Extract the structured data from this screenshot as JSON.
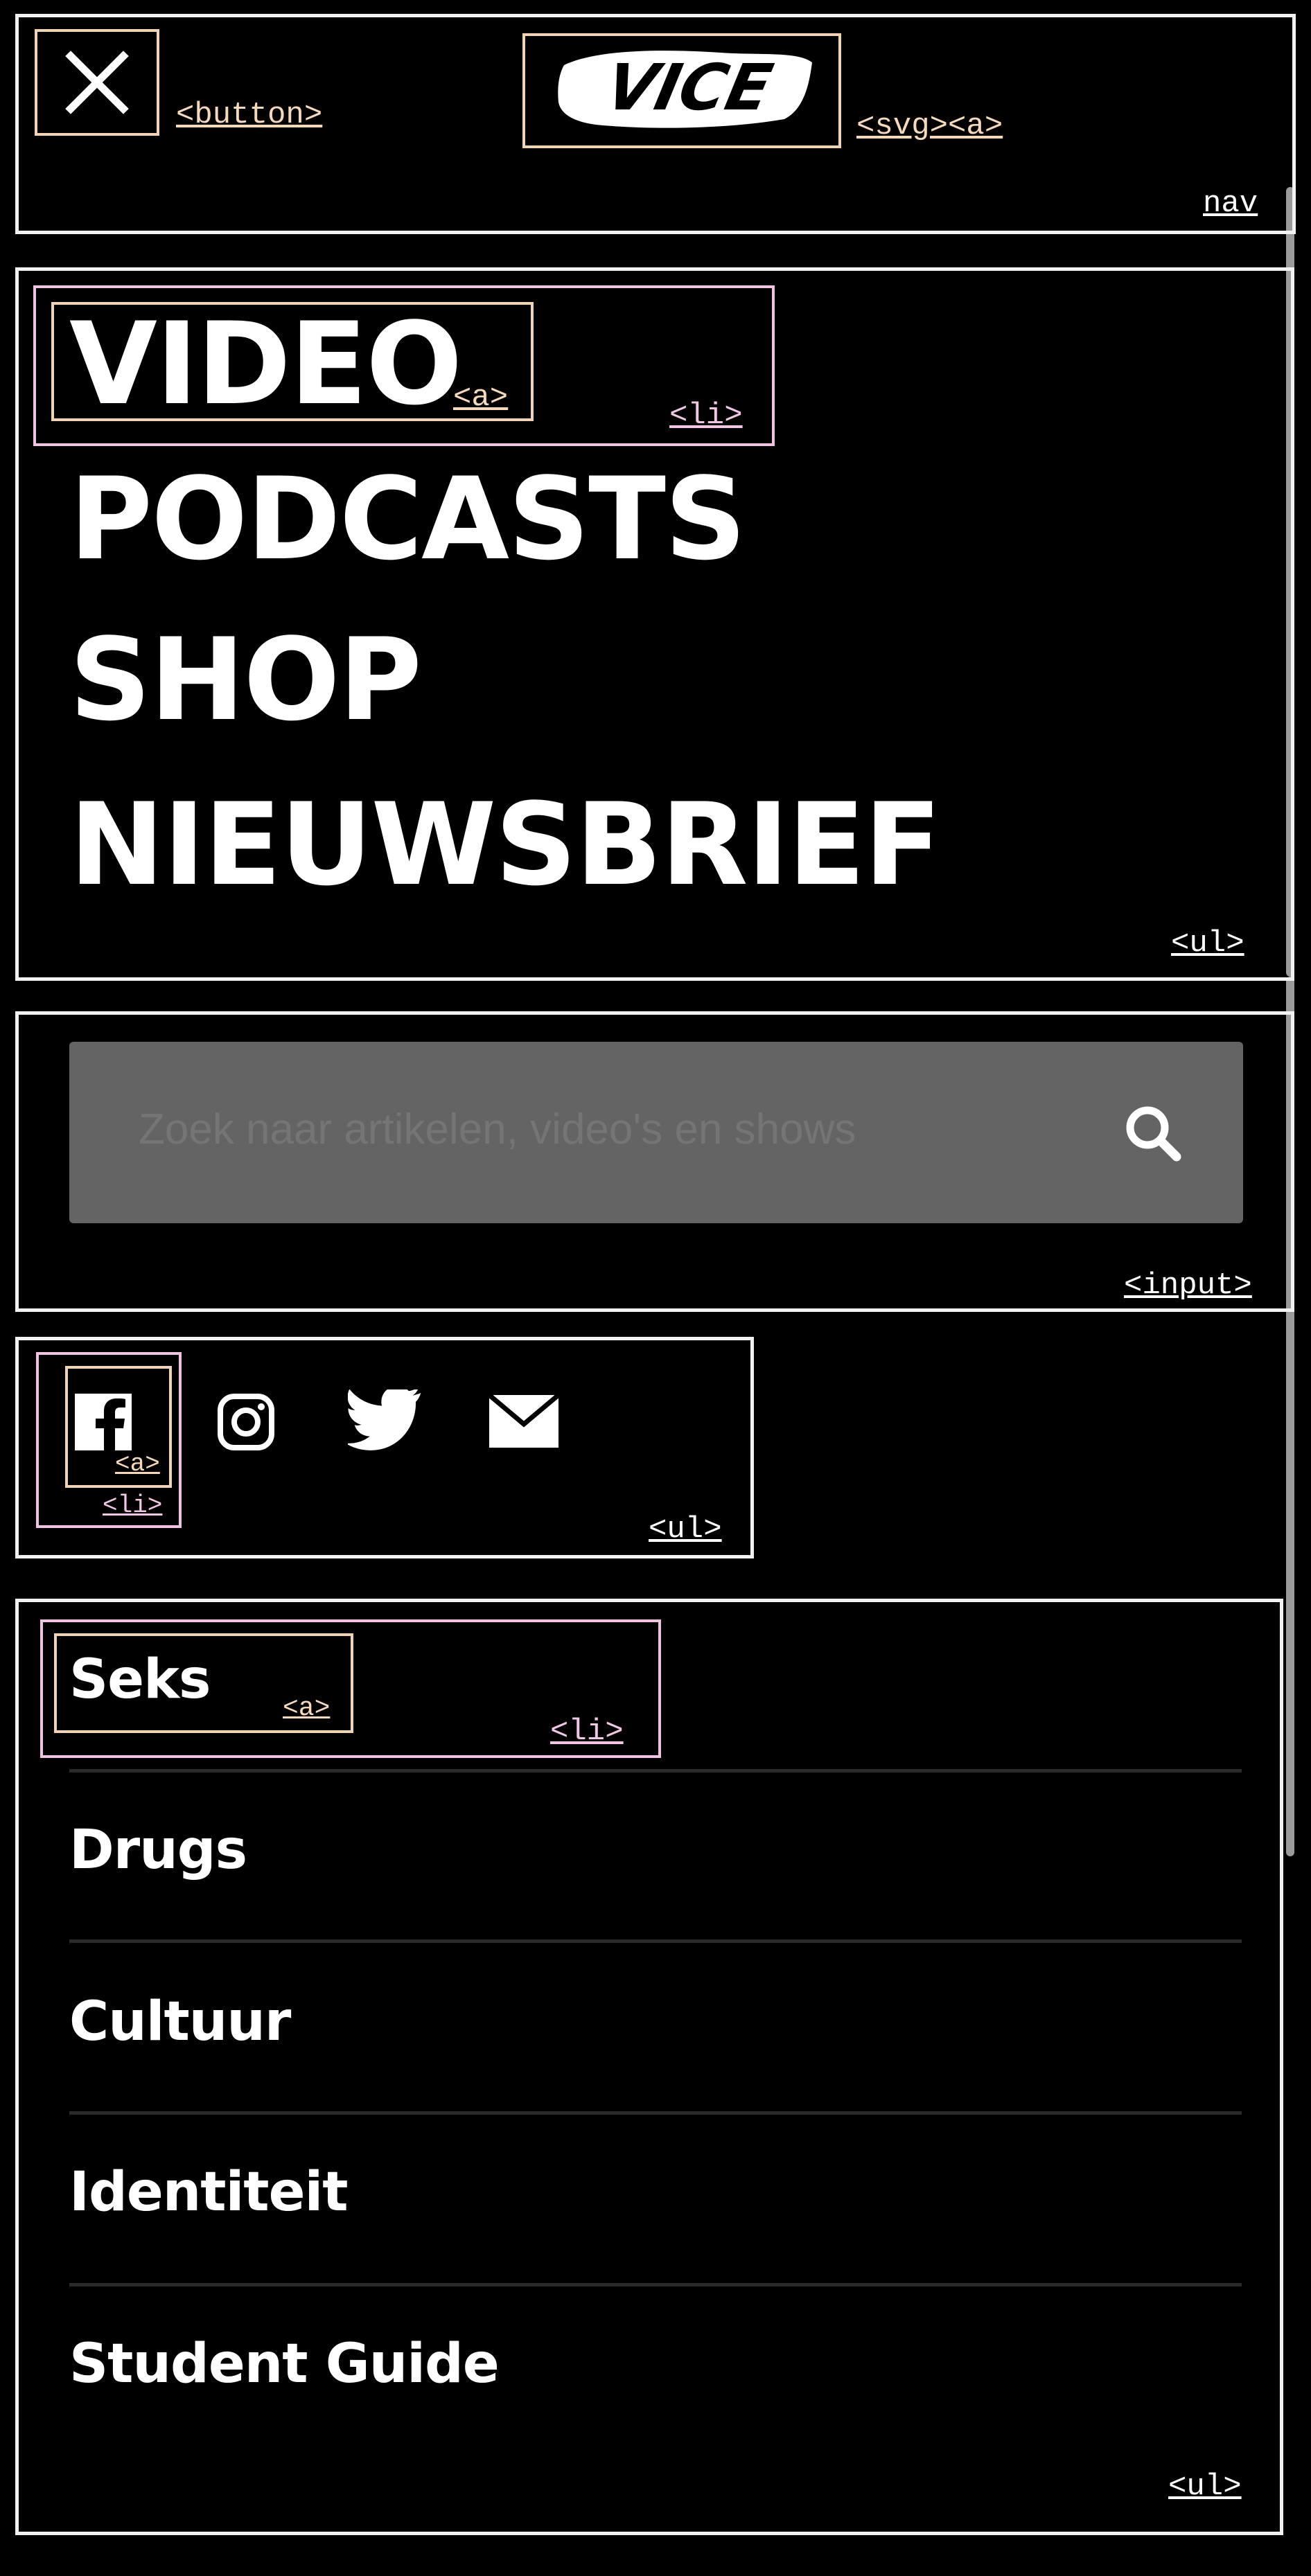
{
  "nav": {
    "tag": "nav",
    "close_tag": "<button>",
    "logo_text": "VICE",
    "logo_tag": "<svg><a>"
  },
  "main_menu": {
    "items": [
      {
        "label": "VIDEO"
      },
      {
        "label": "PODCASTS"
      },
      {
        "label": "SHOP"
      },
      {
        "label": "NIEUWSBRIEF"
      }
    ],
    "a_tag": "<a>",
    "li_tag": "<li>",
    "ul_tag": "<ul>"
  },
  "search": {
    "placeholder": "Zoek naar artikelen, video's en shows",
    "tag": "<input>",
    "field_color": "#646464"
  },
  "social": {
    "icons": [
      "facebook-icon",
      "instagram-icon",
      "twitter-icon",
      "mail-icon"
    ],
    "a_tag": "<a>",
    "li_tag": "<li>",
    "ul_tag": "<ul>"
  },
  "categories": {
    "items": [
      {
        "label": "Seks"
      },
      {
        "label": "Drugs"
      },
      {
        "label": "Cultuur"
      },
      {
        "label": "Identiteit"
      },
      {
        "label": "Student Guide"
      }
    ],
    "a_tag": "<a>",
    "li_tag": "<li>",
    "ul_tag": "<ul>"
  }
}
